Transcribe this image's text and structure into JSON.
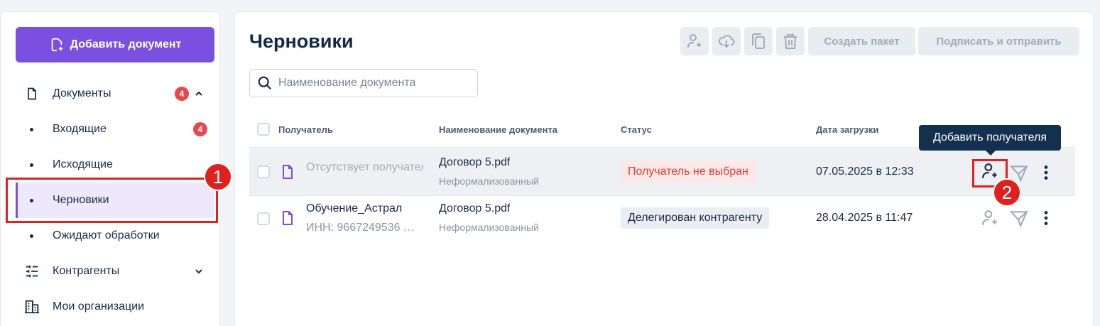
{
  "sidebar": {
    "add_button": "Добавить документ",
    "items": [
      {
        "label": "Документы",
        "badge": "4"
      },
      {
        "label": "Входящие",
        "badge": "4"
      },
      {
        "label": "Исходящие"
      },
      {
        "label": "Черновики"
      },
      {
        "label": "Ожидают обработки"
      },
      {
        "label": "Контрагенты"
      },
      {
        "label": "Мои организации"
      }
    ]
  },
  "main": {
    "title": "Черновики",
    "toolbar": {
      "icons": [
        "add-recipient-icon",
        "cloud-download-icon",
        "copy-icon",
        "trash-icon"
      ],
      "create_package": "Создать пакет",
      "sign_and_send": "Подписать и отправить"
    },
    "search": {
      "placeholder": "Наименование документа",
      "value": ""
    },
    "table": {
      "columns": [
        "Получатель",
        "Наименование документа",
        "Статус",
        "Дата загрузки"
      ],
      "rows": [
        {
          "recipient": "Отсутствует получатель",
          "recipient_sub": "",
          "doc_name": "Договор 5.pdf",
          "doc_type": "Неформализованный",
          "status": "Получатель не выбран",
          "date": "07.05.2025 в 12:33"
        },
        {
          "recipient": "Обучение_Астрал",
          "recipient_sub": "ИНН: 9667249536 …",
          "doc_name": "Договор 5.pdf",
          "doc_type": "Неформализованный",
          "status": "Делегирован контрагенту",
          "date": "28.04.2025 в 11:47"
        }
      ]
    },
    "tooltip": "Добавить получателя"
  },
  "annotations": {
    "callout1": "1",
    "callout2": "2"
  },
  "colors": {
    "accent": "#7b4fe0",
    "badge": "#e5484d",
    "status_error_bg": "#fde8e8",
    "status_error_text": "#e0403a",
    "status_neutral_bg": "#eaedf1",
    "callout": "#e0201d"
  }
}
